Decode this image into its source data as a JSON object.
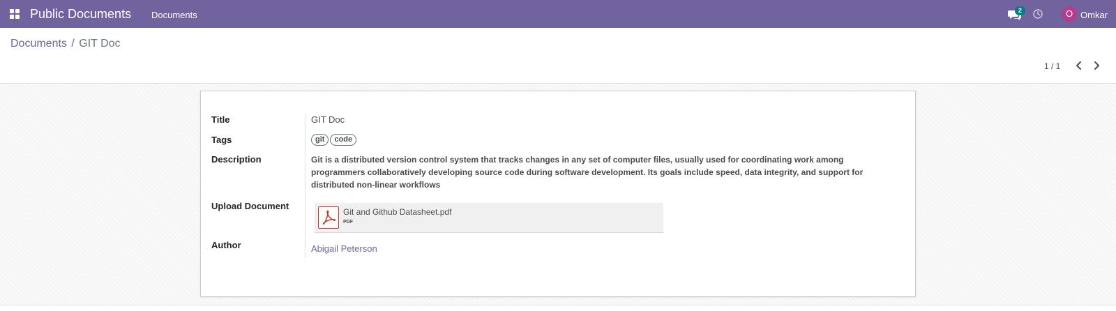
{
  "navbar": {
    "brand": "Public Documents",
    "menu": "Documents",
    "chat_count": "2",
    "user_initial": "O",
    "user_name": "Omkar",
    "color": "#71639e"
  },
  "breadcrumb": {
    "parent": "Documents",
    "separator": "/",
    "current": "GIT Doc"
  },
  "pager": {
    "value": "1 / 1"
  },
  "form": {
    "title_label": "Title",
    "title_value": "GIT Doc",
    "tags_label": "Tags",
    "tags": [
      "git",
      "code"
    ],
    "description_label": "Description",
    "description_value": "Git is a distributed version control system that tracks changes in any set of computer files, usually used for coordinating work among programmers collaboratively developing source code during software development. Its goals include speed, data integrity, and support for distributed non-linear workflows",
    "upload_label": "Upload Document",
    "attachment": {
      "name": "Git and Github Datasheet.pdf",
      "type": "PDF",
      "icon": "pdf-file-icon"
    },
    "author_label": "Author",
    "author_value": "Abigail Peterson"
  }
}
